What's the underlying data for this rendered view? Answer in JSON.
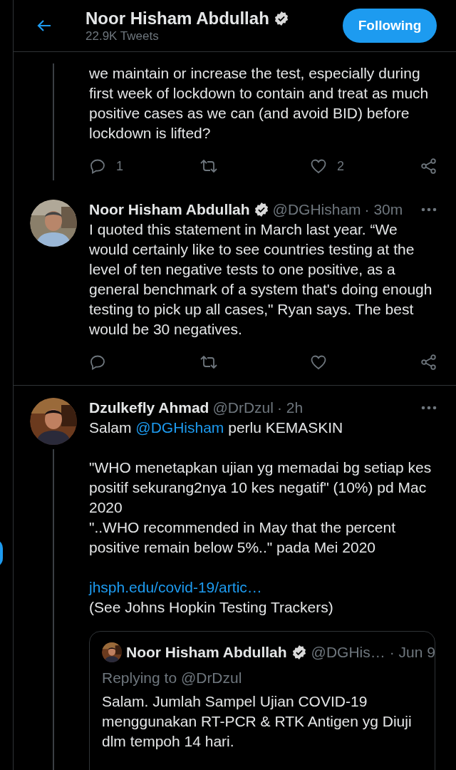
{
  "header": {
    "title": "Noor Hisham Abdullah",
    "verified": true,
    "tweet_count": "22.9K Tweets",
    "follow_button": "Following"
  },
  "tweets": [
    {
      "thread_line": true,
      "body": [
        [
          [
            {
              "kind": "text",
              "text": "we maintain or increase the test, especially during first week of lockdown to contain and treat as much positive cases as we can (and avoid BID) before lockdown is lifted?"
            }
          ]
        ]
      ],
      "actions": [
        {
          "kind": "reply",
          "count": "1"
        },
        {
          "kind": "retweet"
        },
        {
          "kind": "like",
          "count": "2"
        },
        {
          "kind": "share"
        }
      ]
    },
    {
      "thread_line": false,
      "author": {
        "name": "Noor Hisham Abdullah",
        "verified": true,
        "handle": "@DGHisham",
        "time": "· 30m"
      },
      "body": [
        [
          [
            {
              "kind": "text",
              "text": "I quoted this statement in March last year. “We would certainly like to see countries testing at the level of ten negative tests to one positive, as a general benchmark of a system that's doing enough testing to pick up all cases,\" Ryan says.  The best would be 30 negatives."
            }
          ]
        ]
      ],
      "actions": [
        {
          "kind": "reply"
        },
        {
          "kind": "retweet"
        },
        {
          "kind": "like"
        },
        {
          "kind": "share"
        }
      ]
    },
    {
      "thread_line": true,
      "author": {
        "name": "Dzulkefly Ahmad",
        "verified": false,
        "handle": "@DrDzul",
        "time": "· 2h"
      },
      "body": [
        [
          [
            {
              "kind": "text",
              "text": "Salam "
            },
            {
              "kind": "link",
              "text": "@DGHisham"
            },
            {
              "kind": "text",
              "text": " perlu KEMASKIN"
            }
          ]
        ],
        [
          [
            {
              "kind": "text",
              "text": "\"WHO menetapkan ujian yg memadai bg setiap kes positif sekurang2nya 10 kes negatif\" (10%) pd Mac 2020"
            }
          ],
          [
            {
              "kind": "text",
              "text": "\"..WHO recommended in May that the percent positive remain below 5%..\" pada Mei 2020"
            }
          ]
        ],
        [
          [
            {
              "kind": "link",
              "text": "jhsph.edu/covid-19/artic…"
            }
          ],
          [
            {
              "kind": "text",
              "text": "(See Johns Hopkin Testing Trackers)"
            }
          ]
        ]
      ],
      "quote": {
        "name": "Noor Hisham Abdullah",
        "verified": true,
        "handle": "@DGHis…",
        "time": "· Jun 9",
        "replying": "Replying to @DrDzul",
        "text": "Salam. Jumlah Sampel Ujian COVID-19 menggunakan RT-PCR & RTK Antigen yg Diuji dlm tempoh 14 hari."
      }
    }
  ]
}
